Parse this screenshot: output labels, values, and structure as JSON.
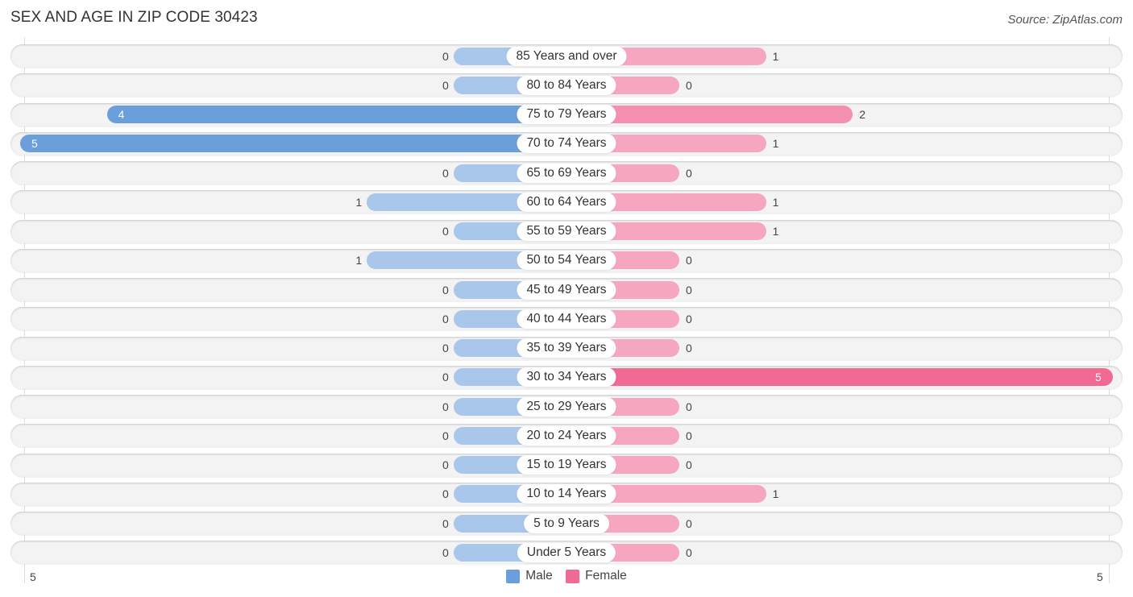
{
  "header": {
    "title": "SEX AND AGE IN ZIP CODE 30423",
    "source": "Source: ZipAtlas.com"
  },
  "colors": {
    "male": "#6a9fdc",
    "male_light": "#a9c7ea",
    "female": "#f06a94",
    "female_light": "#f6a6bf"
  },
  "chart_data": {
    "type": "bar",
    "orientation": "horizontal-diverging",
    "title": "SEX AND AGE IN ZIP CODE 30423",
    "categories": [
      "85 Years and over",
      "80 to 84 Years",
      "75 to 79 Years",
      "70 to 74 Years",
      "65 to 69 Years",
      "60 to 64 Years",
      "55 to 59 Years",
      "50 to 54 Years",
      "45 to 49 Years",
      "40 to 44 Years",
      "35 to 39 Years",
      "30 to 34 Years",
      "25 to 29 Years",
      "20 to 24 Years",
      "15 to 19 Years",
      "10 to 14 Years",
      "5 to 9 Years",
      "Under 5 Years"
    ],
    "series": [
      {
        "name": "Male",
        "values": [
          0,
          0,
          4,
          5,
          0,
          1,
          0,
          1,
          0,
          0,
          0,
          0,
          0,
          0,
          0,
          0,
          0,
          0
        ]
      },
      {
        "name": "Female",
        "values": [
          1,
          0,
          2,
          1,
          0,
          1,
          1,
          0,
          0,
          0,
          0,
          5,
          0,
          0,
          0,
          1,
          0,
          0
        ]
      }
    ],
    "xlim": [
      5,
      5
    ],
    "axis_tick_labels": {
      "left": "5",
      "right": "5"
    },
    "legend": {
      "position": "bottom-center",
      "entries": [
        "Male",
        "Female"
      ]
    },
    "grid": false
  }
}
